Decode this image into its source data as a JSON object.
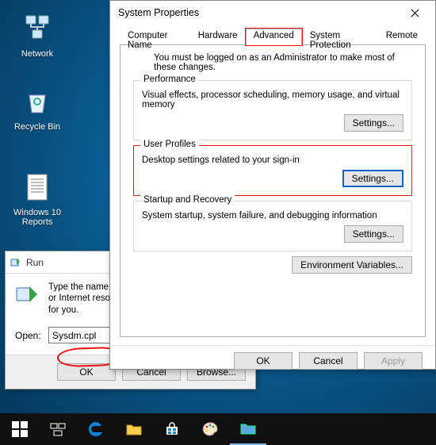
{
  "desktop": {
    "icons": [
      {
        "id": "network",
        "label": "Network"
      },
      {
        "id": "recycle",
        "label": "Recycle Bin"
      },
      {
        "id": "file",
        "label": "Windows 10 Reports"
      }
    ]
  },
  "run": {
    "title": "Run",
    "instruction": "Type the name of a program, folder, document, or Internet resource, and Windows will open it for you.",
    "openLabel": "Open:",
    "value": "Sysdm.cpl",
    "buttons": {
      "ok": "OK",
      "cancel": "Cancel",
      "browse": "Browse..."
    }
  },
  "sysprop": {
    "title": "System Properties",
    "tabs": [
      "Computer Name",
      "Hardware",
      "Advanced",
      "System Protection",
      "Remote"
    ],
    "activeTab": "Advanced",
    "intro": "You must be logged on as an Administrator to make most of these changes.",
    "sections": {
      "perf": {
        "legend": "Performance",
        "desc": "Visual effects, processor scheduling, memory usage, and virtual memory",
        "btn": "Settings..."
      },
      "userprof": {
        "legend": "User Profiles",
        "desc": "Desktop settings related to your sign-in",
        "btn": "Settings..."
      },
      "startup": {
        "legend": "Startup and Recovery",
        "desc": "System startup, system failure, and debugging information",
        "btn": "Settings..."
      }
    },
    "envVarBtn": "Environment Variables...",
    "bottom": {
      "ok": "OK",
      "cancel": "Cancel",
      "apply": "Apply"
    }
  },
  "taskbar": {
    "items": [
      {
        "name": "start-button"
      },
      {
        "name": "task-view-button"
      },
      {
        "name": "edge-browser-button"
      },
      {
        "name": "file-explorer-button"
      },
      {
        "name": "store-button"
      },
      {
        "name": "paint-button"
      },
      {
        "name": "explorer-window-button"
      }
    ]
  }
}
